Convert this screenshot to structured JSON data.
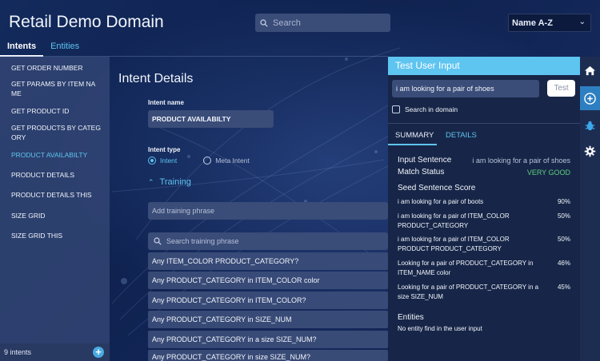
{
  "app": {
    "title": "Retail Demo Domain"
  },
  "search": {
    "placeholder": "Search"
  },
  "sort": {
    "selected": "Name A-Z"
  },
  "tabs": [
    {
      "label": "Intents"
    },
    {
      "label": "Entities"
    }
  ],
  "sidebar": {
    "items": [
      {
        "label": "GET ORDER NUMBER"
      },
      {
        "label": "GET PARAMS BY ITEM NA ME"
      },
      {
        "label": "GET PRODUCT ID"
      },
      {
        "label": "GET PRODUCTS BY CATEG ORY"
      },
      {
        "label": "PRODUCT AVAILABILTY"
      },
      {
        "label": "PRODUCT DETAILS"
      },
      {
        "label": "PRODUCT DETAILS THIS"
      },
      {
        "label": "SIZE GRID"
      },
      {
        "label": "SIZE GRID THIS"
      }
    ],
    "count_label": "9 intents"
  },
  "details": {
    "title": "Intent Details",
    "name_label": "Intent name",
    "name_value": "PRODUCT AVAILABILTY",
    "type_label": "Intent type",
    "type_options": [
      "Intent",
      "Meta Intent"
    ],
    "training_label": "Training",
    "add_placeholder": "Add training phrase",
    "search_placeholder": "Search training phrase",
    "phrases": [
      "Any ITEM_COLOR PRODUCT_CATEGORY?",
      "Any PRODUCT_CATEGORY in ITEM_COLOR color",
      "Any PRODUCT_CATEGORY in ITEM_COLOR?",
      "Any PRODUCT_CATEGORY in SIZE_NUM",
      "Any PRODUCT_CATEGORY in a size SIZE_NUM?",
      "Any PRODUCT_CATEGORY in size SIZE_NUM?"
    ]
  },
  "test": {
    "header": "Test User Input",
    "input_value": "i am looking for a pair of shoes",
    "test_button": "Test",
    "search_domain_label": "Search in domain",
    "tabs": [
      "SUMMARY",
      "DETAILS"
    ],
    "input_sentence_label": "Input Sentence",
    "input_sentence_value": "i am looking for a pair of shoes",
    "match_status_label": "Match Status",
    "match_status_value": "VERY GOOD",
    "match_color": "#5fd07e",
    "seed_title": "Seed Sentence Score",
    "seeds": [
      {
        "text": "i am looking for a pair of boots",
        "score": "90%"
      },
      {
        "text": "i am looking for a pair of ITEM_COLOR PRODUCT_CATEGORY",
        "score": "50%"
      },
      {
        "text": "i am looking for a pair of ITEM_COLOR PRODUCT PRODUCT_CATEGORY",
        "score": "50%"
      },
      {
        "text": "Looking for a pair of PRODUCT_CATEGORY in ITEM_NAME color",
        "score": "46%"
      },
      {
        "text": "Looking for a pair of PRODUCT_CATEGORY in a size SIZE_NUM",
        "score": "45%"
      }
    ],
    "entities_title": "Entities",
    "entities_empty": "No entity find in the user input"
  },
  "iconbar": [
    "home-icon",
    "add-icon",
    "bug-icon",
    "gear-icon"
  ],
  "colors": {
    "accent": "#5ec4f0",
    "panel": "#172648",
    "field": "#3a4c78"
  }
}
